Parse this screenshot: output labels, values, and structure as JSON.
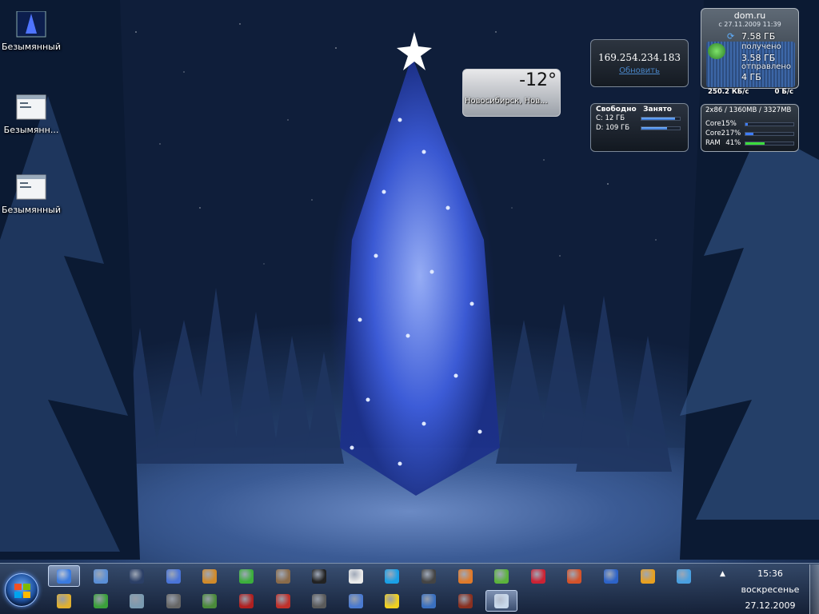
{
  "desktop_icons": [
    {
      "label": "Безымянный",
      "icon": "blue-tree-thumbnail-icon"
    },
    {
      "label": "Безымянн...",
      "icon": "screenshot-window-icon"
    },
    {
      "label": "Безымянный",
      "icon": "screenshot-window-icon"
    }
  ],
  "ip_gadget": {
    "ip": "169.254.234.183",
    "refresh_label": "Обновить"
  },
  "weather_gadget": {
    "temperature": "-12°",
    "city": "Новосибирск, Нов..."
  },
  "disk_gadget": {
    "free_label": "Свободно",
    "used_label": "Занято",
    "drives": [
      {
        "label": "C: 12 ГБ",
        "used_fraction": 0.88
      },
      {
        "label": "D: 109 ГБ",
        "used_fraction": 0.67
      }
    ]
  },
  "traffic_gadget": {
    "provider": "dom.ru",
    "since": "с 27.11.2009 11:39",
    "received_value": "7.58 ГБ",
    "received_label": "получено",
    "sent_value": "3.58 ГБ",
    "sent_label": "отправлено",
    "extra_value": "4 ГБ",
    "speed_down": "250.2 КБ/с",
    "speed_up": "0 Б/с"
  },
  "cpu_gadget": {
    "header": "2x86 / 1360MB / 3327MB",
    "rows": [
      {
        "name": "Core1",
        "percent": "5%",
        "fraction": 0.05
      },
      {
        "name": "Core2",
        "percent": "17%",
        "fraction": 0.17
      },
      {
        "name": "RAM",
        "percent": "41%",
        "fraction": 0.41
      }
    ]
  },
  "taskbar": {
    "start_label": "Пуск",
    "row1_icons": [
      "ie-icon",
      "network-icon",
      "monitor-icon",
      "hedgehog-icon",
      "half-life-icon",
      "utorrent-icon",
      "gimp-icon",
      "face-icon",
      "refresh-icon",
      "skype-icon",
      "steam-icon",
      "target-icon",
      "globe-icon",
      "game-icon",
      "house-icon",
      "save-icon",
      "info-icon",
      "windows-update-icon"
    ],
    "row2_icons": [
      "folder-icon",
      "mp3cut-icon",
      "recycle-icon",
      "disc-icon",
      "chat-icon",
      "game-icon",
      "shield-cross-icon",
      "skull-icon",
      "tower-icon",
      "radiation-icon",
      "cup-icon",
      "sword-icon",
      "paint-icon"
    ],
    "show_hidden_label": "▲"
  },
  "clock": {
    "time": "15:36",
    "day": "воскресенье",
    "date": "27.12.2009"
  },
  "colors": {
    "accent": "#3d6bb1",
    "tree_glow": "#7896ff",
    "sky": "#03050f"
  }
}
